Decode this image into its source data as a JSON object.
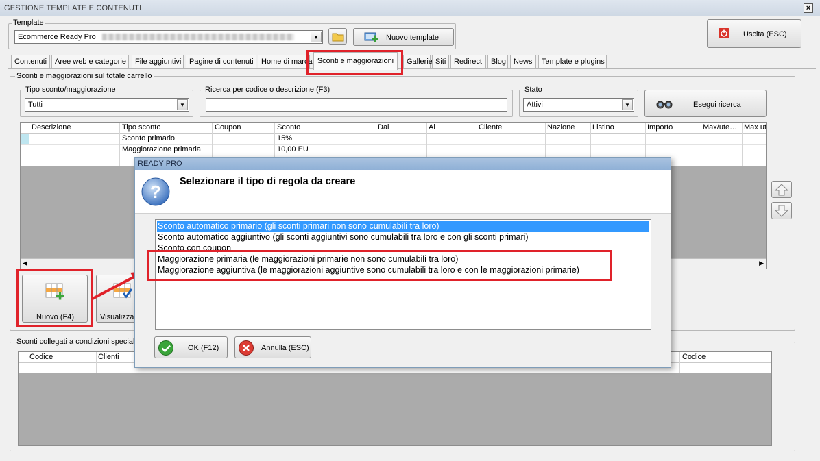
{
  "window": {
    "title": "GESTIONE TEMPLATE E CONTENUTI",
    "close": "×"
  },
  "template_group": {
    "label": "Template",
    "selected": "Ecommerce Ready Pro",
    "new_button": "Nuovo template"
  },
  "exit_button": "Uscita (ESC)",
  "tabs": [
    "Contenuti",
    "Aree web e categorie",
    "File aggiuntivi",
    "Pagine di contenuti",
    "Home di marca",
    "Sconti e maggiorazioni",
    "Gallerie",
    "Siti",
    "Redirect",
    "Blog",
    "News",
    "Template e plugins"
  ],
  "active_tab": "Sconti e maggiorazioni",
  "section": {
    "label": "Sconti e maggiorazioni sul totale carrello",
    "tipo_label": "Tipo sconto/maggiorazione",
    "tipo_value": "Tutti",
    "ricerca_label": "Ricerca per codice o descrizione (F3)",
    "ricerca_value": "",
    "stato_label": "Stato",
    "stato_value": "Attivi",
    "search_button": "Esegui ricerca"
  },
  "grid": {
    "headers": [
      "Descrizione",
      "Tipo sconto",
      "Coupon",
      "Sconto",
      "Dal",
      "Al",
      "Cliente",
      "Nazione",
      "Listino",
      "Importo",
      "Max/ute…",
      "Max ut"
    ],
    "rows": [
      {
        "tipo": "Sconto primario",
        "sconto": "15%"
      },
      {
        "tipo": "Maggiorazione primaria",
        "sconto": "10,00 EU"
      }
    ]
  },
  "buttons": {
    "nuovo": "Nuovo (F4)",
    "visualizza": "Visualizza"
  },
  "bottom_section": {
    "label": "Sconti collegati a condizioni speciali",
    "col_codice": "Codice",
    "col_clienti": "Clienti",
    "col_codice2": "Codice"
  },
  "dialog": {
    "title": "READY PRO",
    "question": "Selezionare il tipo di regola da creare",
    "options": [
      "Sconto automatico primario (gli sconti primari non sono cumulabili tra loro)",
      "Sconto automatico aggiuntivo (gli sconti aggiuntivi sono cumulabili tra loro e con gli sconti primari)",
      "Sconto con coupon",
      "Maggiorazione primaria (le maggiorazioni primarie non sono cumulabili tra loro)",
      "Maggiorazione aggiuntiva (le maggiorazioni aggiuntive sono cumulabili tra loro e con le maggiorazioni primarie)"
    ],
    "selected_index": 0,
    "ok": "OK (F12)",
    "cancel": "Annulla (ESC)"
  },
  "colors": {
    "highlight": "#e0222a",
    "selection": "#3399ff",
    "titlebar": "#8fb0d6"
  }
}
